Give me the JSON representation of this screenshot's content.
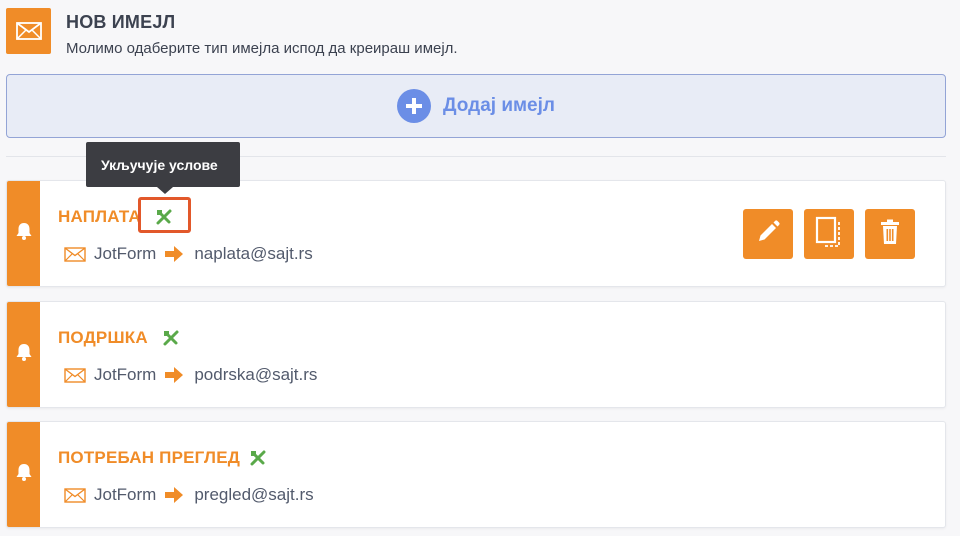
{
  "header": {
    "title": "НОВ ИМЕЈЛ",
    "subtitle": "Молимо одаберите тип имејла испод да креираш имејл.",
    "icon": "envelope-icon"
  },
  "add_email": {
    "label": "Додај имејл",
    "icon": "plus-circle-icon"
  },
  "tooltip": {
    "text": "Укључује услове"
  },
  "colors": {
    "accent": "#f08c28",
    "condition": "#5aa94a",
    "highlight": "#e2582a",
    "add": "#6b8ee6"
  },
  "emails": [
    {
      "title": "НАПЛАТА",
      "sender": "JotForm",
      "recipient": "naplata@sajt.rs",
      "has_conditions": true
    },
    {
      "title": "ПОДРШКА",
      "sender": "JotForm",
      "recipient": "podrska@sajt.rs",
      "has_conditions": true
    },
    {
      "title": "ПОТРЕБАН ПРЕГЛЕД",
      "sender": "JotForm",
      "recipient": "pregled@sajt.rs",
      "has_conditions": true
    }
  ],
  "actions": {
    "edit": "pencil-icon",
    "duplicate": "duplicate-icon",
    "delete": "trash-icon"
  }
}
